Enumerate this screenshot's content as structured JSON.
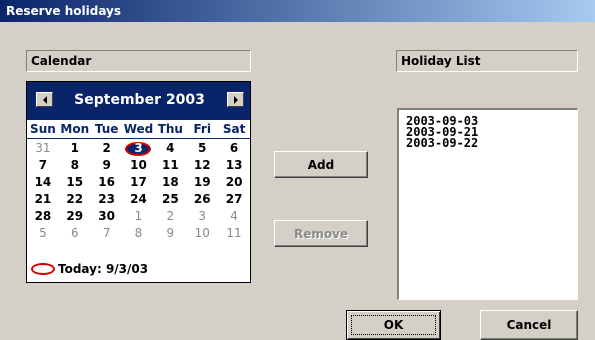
{
  "window": {
    "title": "Reserve holidays"
  },
  "calendar": {
    "label": "Calendar",
    "month_title": "September 2003",
    "weekdays": [
      "Sun",
      "Mon",
      "Tue",
      "Wed",
      "Thu",
      "Fri",
      "Sat"
    ],
    "days": [
      {
        "d": "31",
        "other": true
      },
      {
        "d": "1"
      },
      {
        "d": "2"
      },
      {
        "d": "3",
        "selected": true
      },
      {
        "d": "4"
      },
      {
        "d": "5"
      },
      {
        "d": "6"
      },
      {
        "d": "7"
      },
      {
        "d": "8"
      },
      {
        "d": "9"
      },
      {
        "d": "10"
      },
      {
        "d": "11"
      },
      {
        "d": "12"
      },
      {
        "d": "13"
      },
      {
        "d": "14"
      },
      {
        "d": "15"
      },
      {
        "d": "16"
      },
      {
        "d": "17"
      },
      {
        "d": "18"
      },
      {
        "d": "19"
      },
      {
        "d": "20"
      },
      {
        "d": "21"
      },
      {
        "d": "22"
      },
      {
        "d": "23"
      },
      {
        "d": "24"
      },
      {
        "d": "25"
      },
      {
        "d": "26"
      },
      {
        "d": "27"
      },
      {
        "d": "28"
      },
      {
        "d": "29"
      },
      {
        "d": "30"
      },
      {
        "d": "1",
        "other": true
      },
      {
        "d": "2",
        "other": true
      },
      {
        "d": "3",
        "other": true
      },
      {
        "d": "4",
        "other": true
      },
      {
        "d": "5",
        "other": true
      },
      {
        "d": "6",
        "other": true
      },
      {
        "d": "7",
        "other": true
      },
      {
        "d": "8",
        "other": true
      },
      {
        "d": "9",
        "other": true
      },
      {
        "d": "10",
        "other": true
      },
      {
        "d": "11",
        "other": true
      }
    ],
    "today": "Today: 9/3/03",
    "colors": {
      "header": "#0a246a",
      "annotation": "#d40000"
    }
  },
  "buttons": {
    "add": "Add",
    "remove": "Remove",
    "ok": "OK",
    "cancel": "Cancel"
  },
  "holiday_list": {
    "label": "Holiday List",
    "items": [
      "2003-09-03",
      "2003-09-21",
      "2003-09-22"
    ]
  }
}
